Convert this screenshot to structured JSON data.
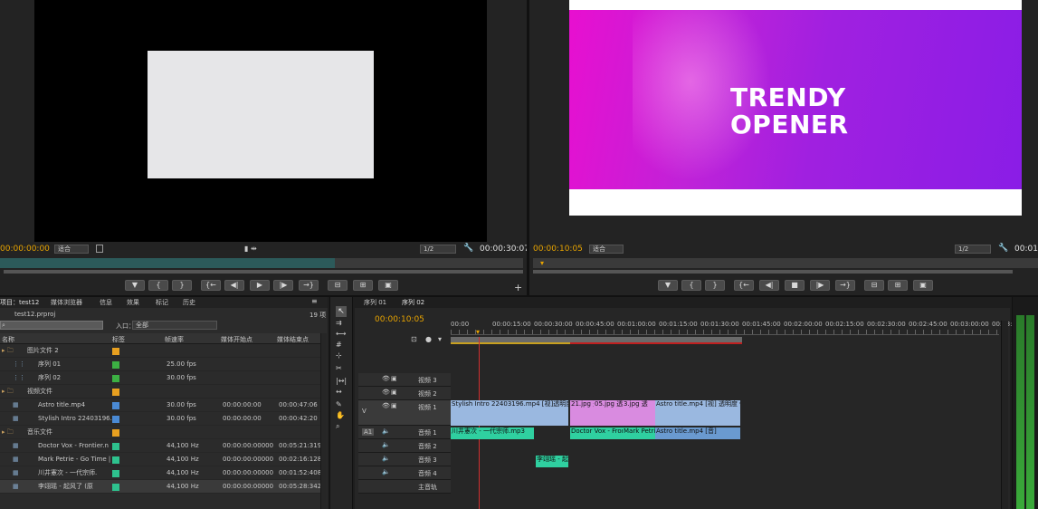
{
  "source_monitor": {
    "timecode_in": "00:00:00:00",
    "fit": "适合",
    "resolution": "1/2",
    "duration": "00:00:30:07"
  },
  "program_monitor": {
    "title_line1": "TRENDY",
    "title_line2": "OPENER",
    "timecode": "00:00:10:05",
    "fit": "适合",
    "resolution": "1/2",
    "duration": "00:01:"
  },
  "project_panel": {
    "tabs": [
      "项目：test12",
      "媒体浏览器",
      "信息",
      "效果",
      "标记",
      "历史"
    ],
    "filename": "test12.prproj",
    "count": "19 项",
    "entry_label": "入口：",
    "entry_value": "全部",
    "columns": [
      "名称",
      "标签",
      "帧速率",
      "媒体开始点",
      "媒体结束点"
    ],
    "rows": [
      {
        "name": "图片文件 2",
        "type": "folder",
        "color": "#e8a020",
        "rate": "",
        "start": "",
        "end": ""
      },
      {
        "name": "序列 01",
        "type": "sequence",
        "color": "#3cb043",
        "rate": "25.00 fps",
        "start": "",
        "end": ""
      },
      {
        "name": "序列 02",
        "type": "sequence",
        "color": "#3cb043",
        "rate": "30.00 fps",
        "start": "",
        "end": ""
      },
      {
        "name": "视频文件",
        "type": "folder",
        "color": "#e8a020",
        "rate": "",
        "start": "",
        "end": ""
      },
      {
        "name": "Astro title.mp4",
        "type": "video",
        "color": "#4a8ad4",
        "rate": "30.00 fps",
        "start": "00:00:00:00",
        "end": "00:00:47:06"
      },
      {
        "name": "Stylish Intro 22403196.",
        "type": "video",
        "color": "#4a8ad4",
        "rate": "30.00 fps",
        "start": "00:00:00:00",
        "end": "00:00:42:20"
      },
      {
        "name": "音乐文件",
        "type": "folder",
        "color": "#e8a020",
        "rate": "",
        "start": "",
        "end": ""
      },
      {
        "name": "Doctor Vox - Frontier.n",
        "type": "audio",
        "color": "#2ec28e",
        "rate": "44,100 Hz",
        "start": "00:00:00:00000",
        "end": "00:05:21:319"
      },
      {
        "name": "Mark Petrie - Go Time |",
        "type": "audio",
        "color": "#2ec28e",
        "rate": "44,100 Hz",
        "start": "00:00:00:00000",
        "end": "00:02:16:128"
      },
      {
        "name": "川井憲次 - 一代宗师.",
        "type": "audio",
        "color": "#2ec28e",
        "rate": "44,100 Hz",
        "start": "00:00:00:00000",
        "end": "00:01:52:408"
      },
      {
        "name": "李翊瑶 - 起风了 (原",
        "type": "audio",
        "color": "#2ec28e",
        "rate": "44,100 Hz",
        "start": "00:00:00:00000",
        "end": "00:05:28:342"
      }
    ]
  },
  "timeline": {
    "tabs": [
      "序列 01",
      "序列 02"
    ],
    "timecode": "00:00:10:05",
    "ruler": [
      "00:00",
      "00:00:15:00",
      "00:00:30:00",
      "00:00:45:00",
      "00:01:00:00",
      "00:01:15:00",
      "00:01:30:00",
      "00:01:45:00",
      "00:02:00:00",
      "00:02:15:00",
      "00:02:30:00",
      "00:02:45:00",
      "00:03:00:00",
      "00:03:1"
    ],
    "tracks": {
      "v3": "视频 3",
      "v2": "视频 2",
      "v1": "视频 1",
      "a1": "音频 1",
      "a2": "音频 2",
      "a3": "音频 3",
      "a4": "音频 4",
      "master": "主音轨"
    },
    "v_label": "V",
    "a1_label": "A1",
    "video_clips": [
      {
        "label": "Stylish Intro 22403196.mp4 [视]透明度 ▾"
      },
      {
        "label": "21.jpg 透"
      },
      {
        "label": "05.jpg 透"
      },
      {
        "label": "3.jpg 透"
      },
      {
        "label": "Astro title.mp4 [视] 透明度 ▾"
      }
    ],
    "audio_clips": [
      {
        "label": "川井憲次 - 一代宗师.mp3"
      },
      {
        "label": "Doctor Vox - Fron"
      },
      {
        "label": "Mark Petri"
      },
      {
        "label": "Astro title.mp4 [音]"
      },
      {
        "label": "李翊瑶 - 起"
      }
    ]
  },
  "colors": {
    "accent": "#e8a400",
    "video_clip": "#9ab8e0",
    "audio_clip": "#2fd0a0",
    "image_clip": "#d98be0"
  }
}
